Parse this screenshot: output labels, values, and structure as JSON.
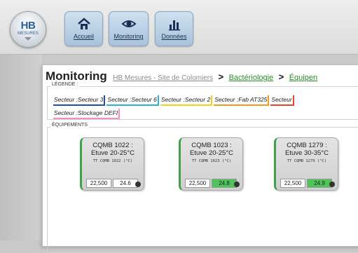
{
  "logo": {
    "text": "HB",
    "sub": "MESURES"
  },
  "nav": [
    {
      "label": "Accueil",
      "icon": "home-icon"
    },
    {
      "label": "Monitoring",
      "icon": "eye-icon"
    },
    {
      "label": "Données",
      "icon": "bar-chart-icon"
    }
  ],
  "breadcrumb": {
    "title": "Monitoring",
    "site": "HB Mesures - Site de Colomiers",
    "sep": ">",
    "level2": "Bactériologie",
    "level3": "Équipen"
  },
  "legend": {
    "label": "LÉGENDE :",
    "sectors": [
      {
        "prefix": "Secteur :",
        "name": "Secteur 3",
        "color": "#1f4fa8"
      },
      {
        "prefix": "Secteur :",
        "name": "Secteur 6",
        "color": "#2bb0d8"
      },
      {
        "prefix": "Secteur :",
        "name": "Secteur 2",
        "color": "#f2d21c"
      },
      {
        "prefix": "Secteur :",
        "name": "Fab AT325",
        "color": "#f29a1c"
      },
      {
        "prefix": "Secteur",
        "name": "",
        "color": "#e8462a"
      },
      {
        "prefix": "Secteur :",
        "name": "Stockage DEFI",
        "color": "#f08fc0"
      }
    ]
  },
  "equipments": {
    "label": "ÉQUIPEMENTS",
    "cards": [
      {
        "name1": "CQMB 1022 :",
        "name2": "Etuve 20-25°C",
        "tt": "TT CQMB 1022 (°C)",
        "v1": "22,500",
        "v2": "24.6",
        "v2_green": false
      },
      {
        "name1": "CQMB 1023 :",
        "name2": "Etuve 20-25°C",
        "tt": "TT CQMB 1023 (°C)",
        "v1": "22,500",
        "v2": "24.8",
        "v2_green": true
      },
      {
        "name1": "CQMB 1279 :",
        "name2": "Etuve 30-35°C",
        "tt": "TT CQMB 1279 (°C)",
        "v1": "22,500",
        "v2": "24.9",
        "v2_green": true
      }
    ]
  }
}
